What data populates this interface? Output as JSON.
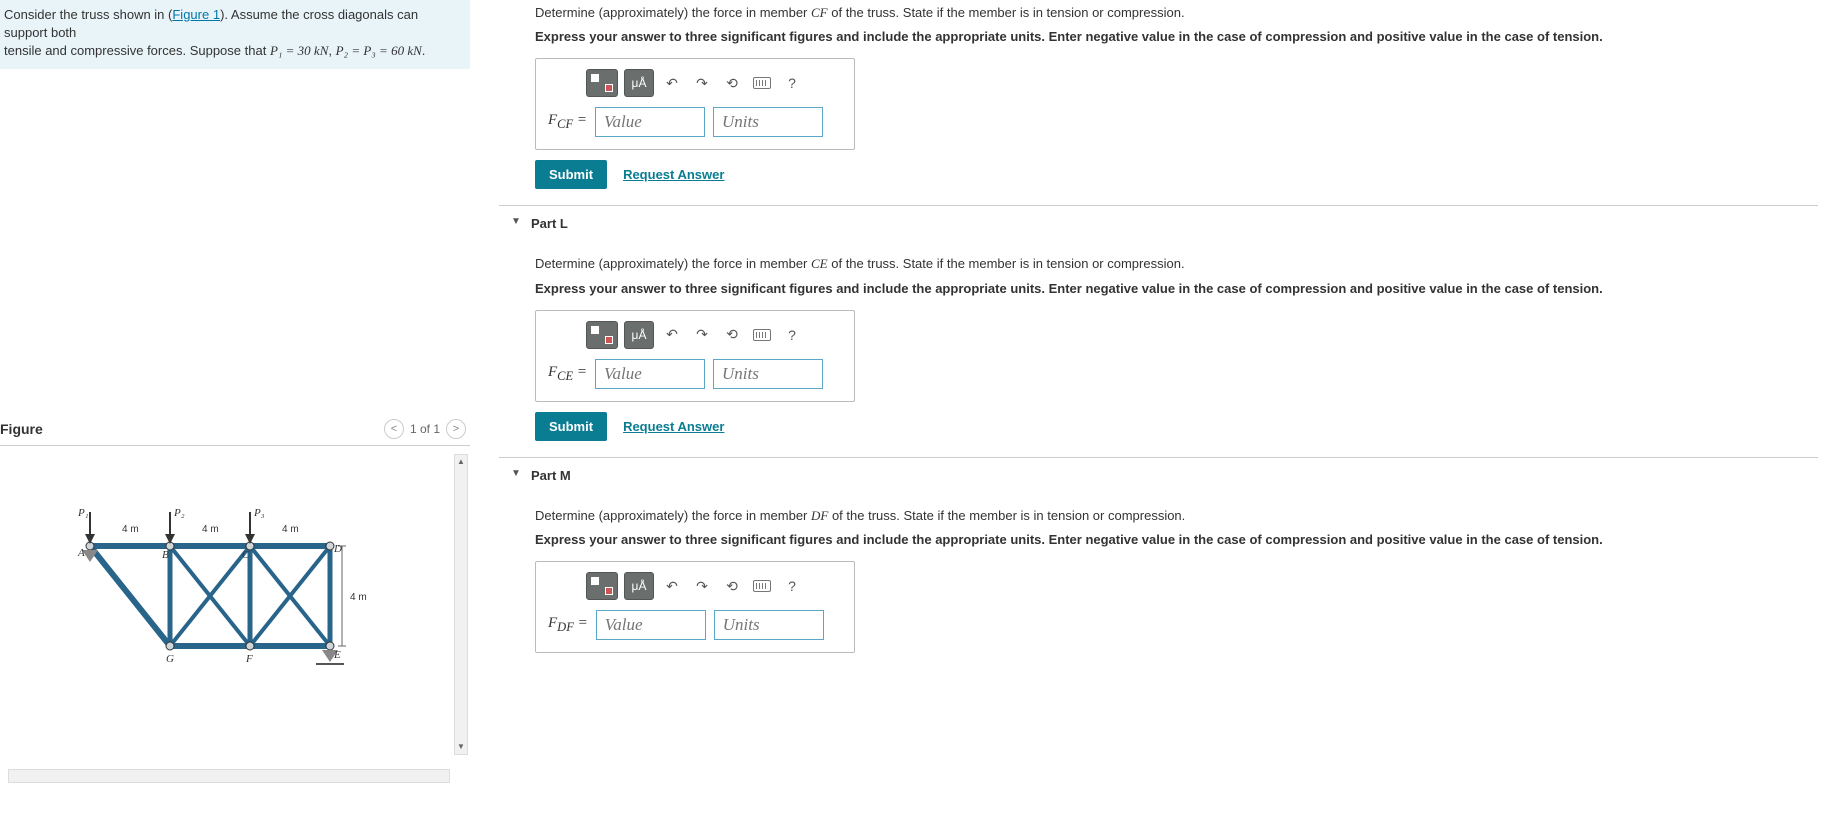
{
  "problem_statement": {
    "line1_prefix": "Consider the truss shown in (",
    "figure_link": "Figure 1",
    "line1_suffix": "). Assume the cross diagonals can support both",
    "line2_prefix": "tensile and compressive forces. Suppose that ",
    "p1": "P₁ = 30 kN",
    "sep": ", ",
    "p2": "P₂ = P₃ = 60 kN",
    "end": "."
  },
  "figure": {
    "title": "Figure",
    "counter": "1 of 1",
    "dims": {
      "span": "4 m",
      "height": "4 m"
    },
    "labels": {
      "A": "A",
      "B": "B",
      "C": "C",
      "D": "D",
      "E": "E",
      "F": "F",
      "G": "G",
      "P1": "P₁",
      "P2": "P₂",
      "P3": "P₃"
    }
  },
  "common": {
    "instruction": "Express your answer to three significant figures and include the appropriate units. Enter negative value in the case of compression and positive value in the case of tension.",
    "value_placeholder": "Value",
    "units_placeholder": "Units",
    "submit": "Submit",
    "request": "Request Answer",
    "mu": "μÅ",
    "qmark": "?"
  },
  "parts": [
    {
      "member_html": "CF",
      "prompt_prefix": "Determine (approximately) the force in member ",
      "prompt_suffix": " of the truss. State if the member is in tension or compression.",
      "var_label_html": "F<sub>CF</sub> ="
    },
    {
      "heading": "Part L",
      "member_html": "CE",
      "prompt_prefix": "Determine (approximately) the force in member ",
      "prompt_suffix": " of the truss. State if the member is in tension or compression.",
      "var_label_html": "F<sub>CE</sub> ="
    },
    {
      "heading": "Part M",
      "member_html": "DF",
      "prompt_prefix": "Determine (approximately) the force in member ",
      "prompt_suffix": " of the truss. State if the member is in tension or compression.",
      "var_label_html": "F<sub>DF</sub> ="
    }
  ]
}
